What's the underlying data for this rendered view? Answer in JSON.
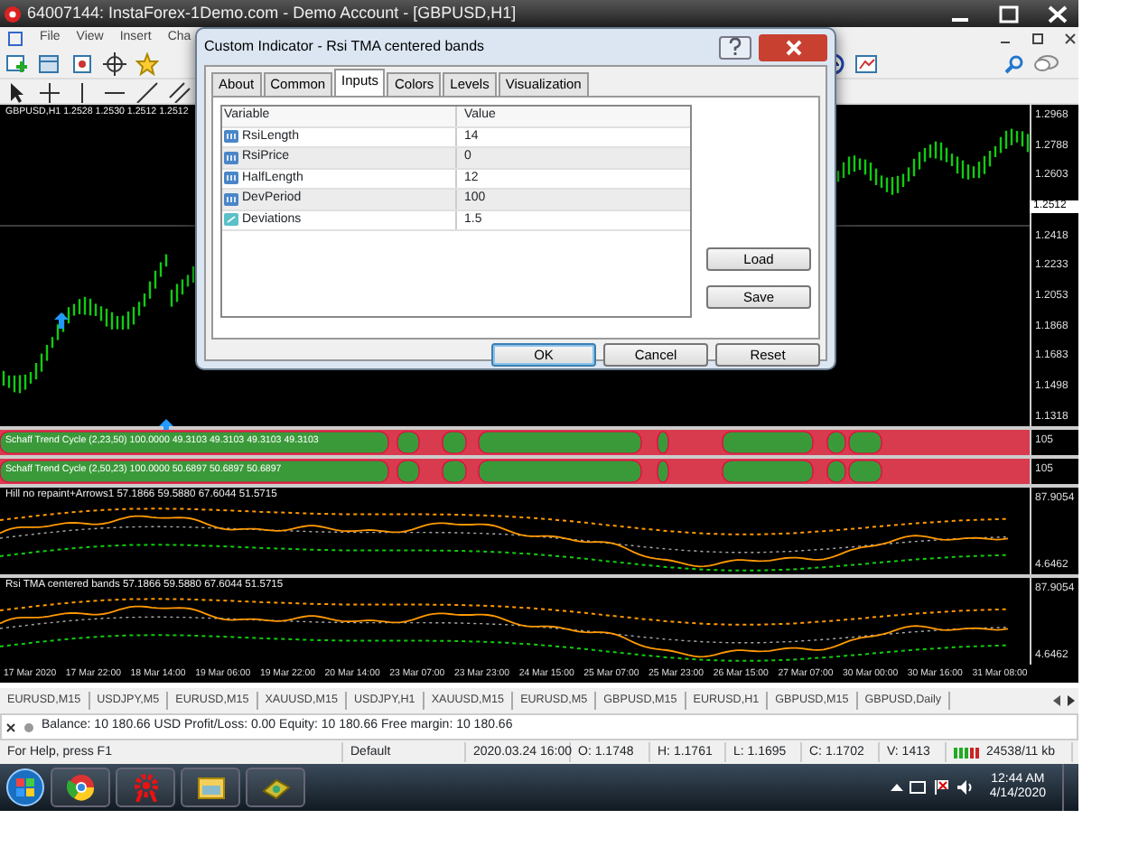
{
  "window": {
    "title": "64007144: InstaForex-1Demo.com - Demo Account - [GBPUSD,H1]"
  },
  "menu": [
    "File",
    "View",
    "Insert",
    "Cha"
  ],
  "chart": {
    "header": "GBPUSD,H1 1.2528 1.2530 1.2512 1.2512",
    "price_axis": [
      "1.2968",
      "1.2788",
      "1.2603",
      "1.2418",
      "1.2233",
      "1.2053",
      "1.1868",
      "1.1683",
      "1.1498",
      "1.1318"
    ],
    "current_price": "1.2512"
  },
  "indicators": [
    {
      "kind": "trend-bar",
      "label": "Schaff Trend Cycle (2,23,50) 100.0000 49.3103 49.3103 49.3103 49.3103",
      "axis": [
        "105"
      ]
    },
    {
      "kind": "trend-bar",
      "label": "Schaff Trend Cycle (2,50,23) 100.0000 50.6897 50.6897 50.6897",
      "axis": [
        "105"
      ]
    },
    {
      "kind": "bands",
      "label": "Hill no repaint+Arrows1 57.1866 59.5880 67.6044 51.5715",
      "axis": [
        "87.9054",
        "4.6462"
      ]
    },
    {
      "kind": "bands",
      "label": "Rsi  TMA centered  bands 57.1866 59.5880 67.6044 51.5715",
      "axis": [
        "87.9054",
        "4.6462"
      ]
    }
  ],
  "time_axis": [
    "17 Mar 2020",
    "17 Mar 22:00",
    "18 Mar 14:00",
    "19 Mar 06:00",
    "19 Mar 22:00",
    "20 Mar 14:00",
    "23 Mar 07:00",
    "23 Mar 23:00",
    "24 Mar 15:00",
    "25 Mar 07:00",
    "25 Mar 23:00",
    "26 Mar 15:00",
    "27 Mar 07:00",
    "30 Mar 00:00",
    "30 Mar 16:00",
    "31 Mar 08:00"
  ],
  "dialog": {
    "title": "Custom Indicator - Rsi  TMA centered  bands",
    "tabs": [
      {
        "label": "About",
        "selected": false
      },
      {
        "label": "Common",
        "selected": false
      },
      {
        "label": "Inputs",
        "selected": true
      },
      {
        "label": "Colors",
        "selected": false
      },
      {
        "label": "Levels",
        "selected": false
      },
      {
        "label": "Visualization",
        "selected": false
      }
    ],
    "table": {
      "columns": [
        "Variable",
        "Value"
      ],
      "rows": [
        {
          "kind": "int",
          "variable": "RsiLength",
          "value": "14"
        },
        {
          "kind": "int",
          "variable": "RsiPrice",
          "value": "0"
        },
        {
          "kind": "int",
          "variable": "HalfLength",
          "value": "12"
        },
        {
          "kind": "int",
          "variable": "DevPeriod",
          "value": "100"
        },
        {
          "kind": "double",
          "variable": "Deviations",
          "value": "1.5"
        }
      ]
    },
    "side_buttons": [
      "Load",
      "Save"
    ],
    "buttons": [
      {
        "label": "OK",
        "default": true
      },
      {
        "label": "Cancel",
        "default": false
      },
      {
        "label": "Reset",
        "default": false
      }
    ]
  },
  "chart_tabs": [
    {
      "label": "EURUSD,M15",
      "selected": false
    },
    {
      "label": "USDJPY,M5",
      "selected": false
    },
    {
      "label": "EURUSD,M15",
      "selected": false
    },
    {
      "label": "XAUUSD,M15",
      "selected": false
    },
    {
      "label": "USDJPY,H1",
      "selected": false
    },
    {
      "label": "XAUUSD,M15",
      "selected": false
    },
    {
      "label": "EURUSD,M5",
      "selected": false
    },
    {
      "label": "GBPUSD,M15",
      "selected": false
    },
    {
      "label": "EURUSD,H1",
      "selected": false
    },
    {
      "label": "GBPUSD,M15",
      "selected": false
    },
    {
      "label": "GBPUSD,Daily",
      "selected": false
    }
  ],
  "terminal": {
    "balance": "Balance: 10 180.66 USD  Profit/Loss: 0.00  Equity: 10 180.66  Free margin: 10 180.66"
  },
  "status_bar": [
    "For Help, press F1",
    "Default",
    "2020.03.24 16:00",
    "O: 1.1748",
    "H: 1.1761",
    "L: 1.1695",
    "C: 1.1702",
    "V: 1413",
    "24538/11 kb"
  ],
  "taskbar": {
    "time": "12:44 AM",
    "date": "4/14/2020"
  }
}
